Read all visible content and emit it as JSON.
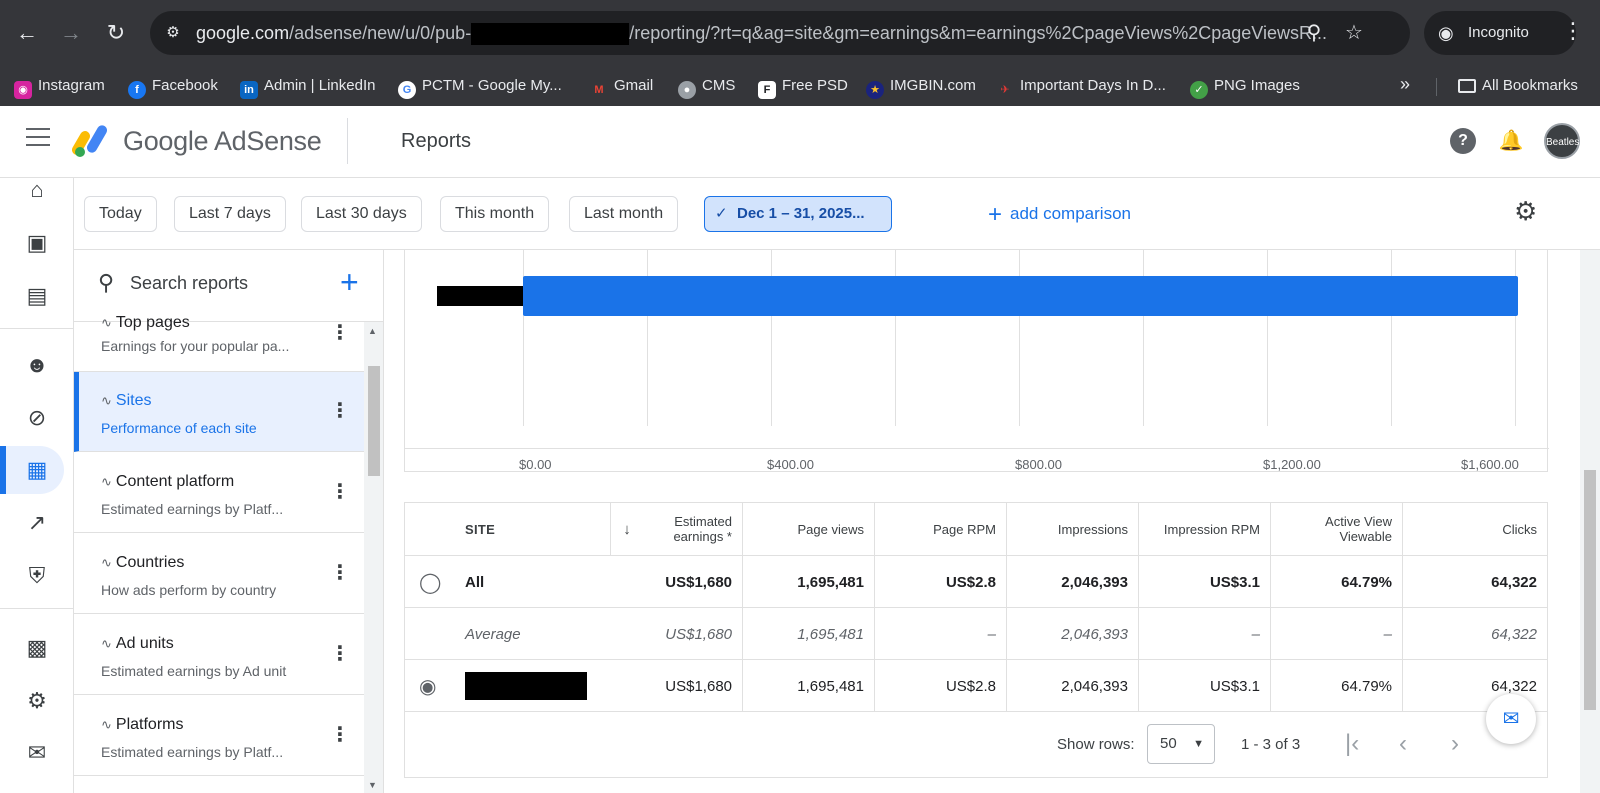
{
  "browser": {
    "url_prefix": "google.com",
    "url_path_a": "/adsense/new/u/0/pub-",
    "url_path_b": "/reporting/?rt=q&ag=site&gm=earnings&m=earnings%2CpageViews%2CpageViewsR...",
    "incognito_label": "Incognito",
    "bookmarks": [
      {
        "label": "Instagram",
        "icon": "instagram-icon",
        "color": "#d6249f"
      },
      {
        "label": "Facebook",
        "icon": "facebook-icon",
        "color": "#1877f2"
      },
      {
        "label": "Admin | LinkedIn",
        "icon": "linkedin-icon",
        "color": "#0a66c2"
      },
      {
        "label": "PCTM - Google My...",
        "icon": "google-icon",
        "color": "#ffffff"
      },
      {
        "label": "Gmail",
        "icon": "gmail-icon",
        "color": "#ea4335"
      },
      {
        "label": "CMS",
        "icon": "globe-icon",
        "color": "#9aa0a6"
      },
      {
        "label": "Free PSD",
        "icon": "freepik-icon",
        "color": "#202124"
      },
      {
        "label": "IMGBIN.com",
        "icon": "star-icon",
        "color": "#1a237e"
      },
      {
        "label": "Important Days In D...",
        "icon": "plane-icon",
        "color": "#c62828"
      },
      {
        "label": "PNG Images",
        "icon": "pngimages-icon",
        "color": "#43a047"
      }
    ],
    "all_bookmarks_label": "All Bookmarks"
  },
  "header": {
    "brand": "Google AdSense",
    "title": "Reports",
    "avatar_text": "Beatles"
  },
  "filters": {
    "chips": [
      "Today",
      "Last 7 days",
      "Last 30 days",
      "This month",
      "Last month"
    ],
    "selected_range": "Dec 1 – 31, 2025...",
    "add_comparison": "add comparison"
  },
  "reports_panel": {
    "search_placeholder": "Search reports",
    "items": [
      {
        "title": "Top pages",
        "subtitle": "Earnings for your popular pa..."
      },
      {
        "title": "Sites",
        "subtitle": "Performance of each site",
        "active": true
      },
      {
        "title": "Content platform",
        "subtitle": "Estimated earnings by Platf..."
      },
      {
        "title": "Countries",
        "subtitle": "How ads perform by country"
      },
      {
        "title": "Ad units",
        "subtitle": "Estimated earnings by Ad unit"
      },
      {
        "title": "Platforms",
        "subtitle": "Estimated earnings by Platf..."
      }
    ]
  },
  "chart_data": {
    "type": "bar",
    "orientation": "horizontal",
    "categories": [
      "[redacted site]"
    ],
    "values": [
      1680
    ],
    "xlim": [
      0,
      1600
    ],
    "x_ticks": [
      "$0.00",
      "$400.00",
      "$800.00",
      "$1,200.00",
      "$1,600.00"
    ],
    "bar_color": "#1a73e8",
    "grid": true
  },
  "table": {
    "headers": {
      "site": "SITE",
      "earnings": "Estimated earnings *",
      "page_views": "Page views",
      "page_rpm": "Page RPM",
      "impressions": "Impressions",
      "impression_rpm": "Impression RPM",
      "active_view": "Active View Viewable",
      "clicks": "Clicks"
    },
    "rows": [
      {
        "site": "All",
        "earnings": "US$1,680",
        "page_views": "1,695,481",
        "page_rpm": "US$2.8",
        "impressions": "2,046,393",
        "impression_rpm": "US$3.1",
        "active_view": "64.79%",
        "clicks": "64,322"
      },
      {
        "site": "Average",
        "earnings": "US$1,680",
        "page_views": "1,695,481",
        "page_rpm": "–",
        "impressions": "2,046,393",
        "impression_rpm": "–",
        "active_view": "–",
        "clicks": "64,322"
      },
      {
        "site": "",
        "earnings": "US$1,680",
        "page_views": "1,695,481",
        "page_rpm": "US$2.8",
        "impressions": "2,046,393",
        "impression_rpm": "US$3.1",
        "active_view": "64.79%",
        "clicks": "64,322"
      }
    ]
  },
  "pagination": {
    "show_rows_label": "Show rows:",
    "rows_value": "50",
    "range_text": "1 - 3 of 3"
  },
  "colors": {
    "accent": "#1a73e8",
    "chrome": "#35363a"
  }
}
